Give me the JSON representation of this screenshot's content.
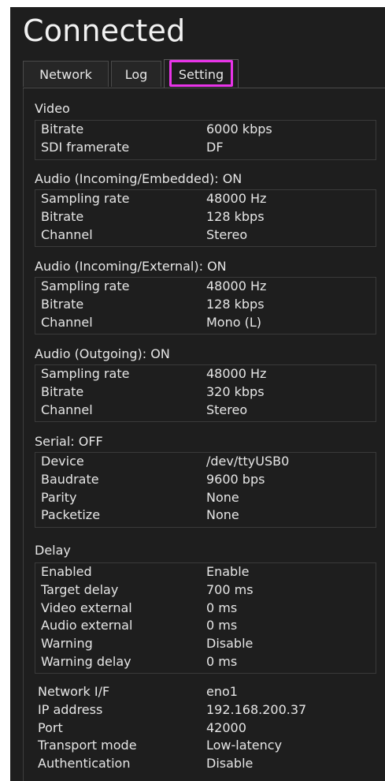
{
  "title": "Connected",
  "tabs": [
    {
      "label": "Network",
      "active": false
    },
    {
      "label": "Log",
      "active": false
    },
    {
      "label": "Setting",
      "active": true
    }
  ],
  "sections": {
    "video": {
      "title": "Video",
      "rows": [
        {
          "key": "Bitrate",
          "value": "6000 kbps"
        },
        {
          "key": "SDI framerate",
          "value": "DF"
        }
      ]
    },
    "audio_embedded": {
      "title": "Audio (Incoming/Embedded): ON",
      "rows": [
        {
          "key": "Sampling rate",
          "value": "48000 Hz"
        },
        {
          "key": "Bitrate",
          "value": "128 kbps"
        },
        {
          "key": "Channel",
          "value": "Stereo"
        }
      ]
    },
    "audio_external": {
      "title": "Audio (Incoming/External): ON",
      "rows": [
        {
          "key": "Sampling rate",
          "value": "48000 Hz"
        },
        {
          "key": "Bitrate",
          "value": "128 kbps"
        },
        {
          "key": "Channel",
          "value": "Mono (L)"
        }
      ]
    },
    "audio_outgoing": {
      "title": "Audio (Outgoing): ON",
      "rows": [
        {
          "key": "Sampling rate",
          "value": "48000 Hz"
        },
        {
          "key": "Bitrate",
          "value": "320 kbps"
        },
        {
          "key": "Channel",
          "value": "Stereo"
        }
      ]
    },
    "serial": {
      "title": "Serial: OFF",
      "rows": [
        {
          "key": "Device",
          "value": "/dev/ttyUSB0"
        },
        {
          "key": "Baudrate",
          "value": "9600 bps"
        },
        {
          "key": "Parity",
          "value": "None"
        },
        {
          "key": "Packetize",
          "value": "None"
        }
      ]
    },
    "delay": {
      "title": "Delay",
      "rows": [
        {
          "key": "Enabled",
          "value": "Enable"
        },
        {
          "key": "Target delay",
          "value": "700 ms"
        },
        {
          "key": "Video external",
          "value": "0 ms"
        },
        {
          "key": "Audio external",
          "value": "0 ms"
        },
        {
          "key": "Warning",
          "value": "Disable"
        },
        {
          "key": "Warning delay",
          "value": "0 ms"
        }
      ]
    },
    "network": {
      "rows": [
        {
          "key": "Network I/F",
          "value": "eno1"
        },
        {
          "key": "IP address",
          "value": "192.168.200.37"
        },
        {
          "key": "Port",
          "value": "42000"
        },
        {
          "key": "Transport mode",
          "value": "Low-latency"
        },
        {
          "key": "Authentication",
          "value": "Disable"
        }
      ]
    }
  },
  "colors": {
    "background": "#1e1e1e",
    "text": "#e6e6e6",
    "active_tab_highlight": "#e834e8"
  }
}
